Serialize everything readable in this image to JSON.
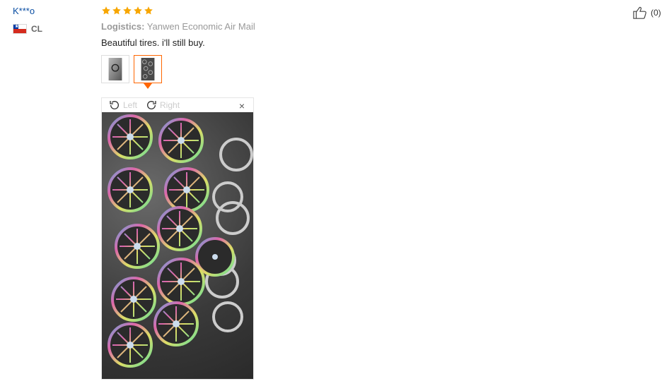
{
  "reviewer": {
    "name": "K***o",
    "country": "CL",
    "flag_icon": "chile-flag-icon"
  },
  "rating": {
    "stars": 5,
    "color": "#f7a600"
  },
  "logistics": {
    "label": "Logistics:",
    "value": "Yanwen Economic Air Mail"
  },
  "comment": "Beautiful tires. i'll still buy.",
  "thumbnails": [
    {
      "name": "photo-1"
    },
    {
      "name": "photo-2",
      "active": true
    }
  ],
  "viewer": {
    "left_label": "Left",
    "right_label": "Right",
    "close_icon": "×"
  },
  "helpful": {
    "count": "(0)"
  }
}
